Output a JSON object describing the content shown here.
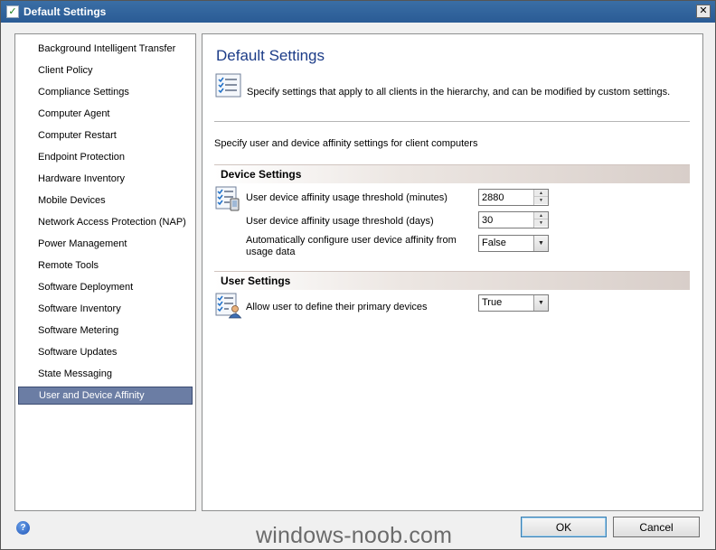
{
  "window": {
    "title": "Default Settings",
    "close_glyph": "✕"
  },
  "nav": {
    "items": [
      {
        "label": "Background Intelligent Transfer",
        "selected": false
      },
      {
        "label": "Client Policy",
        "selected": false
      },
      {
        "label": "Compliance Settings",
        "selected": false
      },
      {
        "label": "Computer Agent",
        "selected": false
      },
      {
        "label": "Computer Restart",
        "selected": false
      },
      {
        "label": "Endpoint Protection",
        "selected": false
      },
      {
        "label": "Hardware Inventory",
        "selected": false
      },
      {
        "label": "Mobile Devices",
        "selected": false
      },
      {
        "label": "Network Access Protection (NAP)",
        "selected": false
      },
      {
        "label": "Power Management",
        "selected": false
      },
      {
        "label": "Remote Tools",
        "selected": false
      },
      {
        "label": "Software Deployment",
        "selected": false
      },
      {
        "label": "Software Inventory",
        "selected": false
      },
      {
        "label": "Software Metering",
        "selected": false
      },
      {
        "label": "Software Updates",
        "selected": false
      },
      {
        "label": "State Messaging",
        "selected": false
      },
      {
        "label": "User and Device Affinity",
        "selected": true
      }
    ]
  },
  "main": {
    "title": "Default Settings",
    "description": "Specify settings that apply to all clients in the hierarchy, and can be modified by custom settings.",
    "subdescription": "Specify user and device affinity settings for client computers",
    "device_settings": {
      "heading": "Device Settings",
      "threshold_minutes": {
        "label": "User device affinity usage threshold (minutes)",
        "value": "2880"
      },
      "threshold_days": {
        "label": "User device affinity usage threshold (days)",
        "value": "30"
      },
      "auto_configure": {
        "label": "Automatically configure user device affinity from usage data",
        "value": "False"
      }
    },
    "user_settings": {
      "heading": "User Settings",
      "allow_primary": {
        "label": "Allow user to define their primary devices",
        "value": "True"
      }
    }
  },
  "footer": {
    "help_glyph": "?",
    "ok_label": "OK",
    "cancel_label": "Cancel",
    "watermark": "windows-noob.com"
  },
  "icons": {
    "title": "checklist-icon",
    "header": "settings-checklist-icon",
    "device": "device-checklist-icon",
    "user": "user-checklist-icon",
    "help": "help-icon"
  },
  "colors": {
    "titlebar": "#2a5b95",
    "selected_nav": "#6b7da4",
    "page_title": "#1c3c88"
  }
}
